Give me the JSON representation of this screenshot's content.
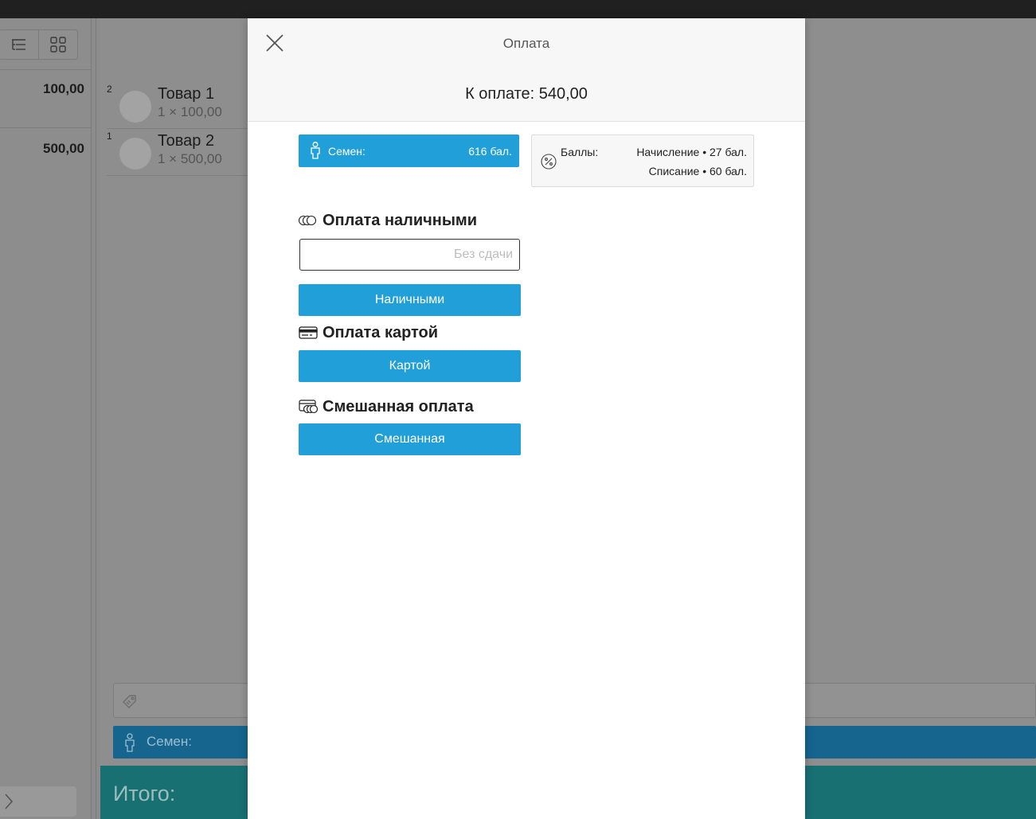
{
  "background": {
    "left_prices": [
      "100,00",
      "500,00"
    ],
    "items": [
      {
        "qty": "2",
        "name": "Товар 1",
        "detail": "1 × 100,00"
      },
      {
        "qty": "1",
        "name": "Товар 2",
        "detail": "1 × 500,00"
      }
    ],
    "client_label": "Семен:",
    "total_label": "Итого:"
  },
  "modal": {
    "title": "Оплата",
    "amount_due": "К оплате: 540,00",
    "client": {
      "name": "Семен:",
      "points": "616 бал."
    },
    "points": {
      "label": "Баллы:",
      "accrual": "Начисление • 27 бал.",
      "write_off": "Списание • 60 бал."
    },
    "cash": {
      "title": "Оплата наличными",
      "input_value": "",
      "input_placeholder": "Без сдачи",
      "button": "Наличными"
    },
    "card": {
      "title": "Оплата картой",
      "button": "Картой"
    },
    "mixed": {
      "title": "Смешанная оплата",
      "button": "Смешанная"
    }
  },
  "colors": {
    "accent": "#219fd9",
    "overlay_client_bar": "#15658f",
    "overlay_total_bar": "#187073",
    "topbar": "#202020"
  },
  "icons": {
    "close": "close-icon",
    "client": "person-icon",
    "points": "percent-icon",
    "cash": "coins-icon",
    "card": "credit-card-icon",
    "mixed": "mixed-payment-icon",
    "coupon": "tag-icon",
    "expand": "chevron-right-icon"
  }
}
